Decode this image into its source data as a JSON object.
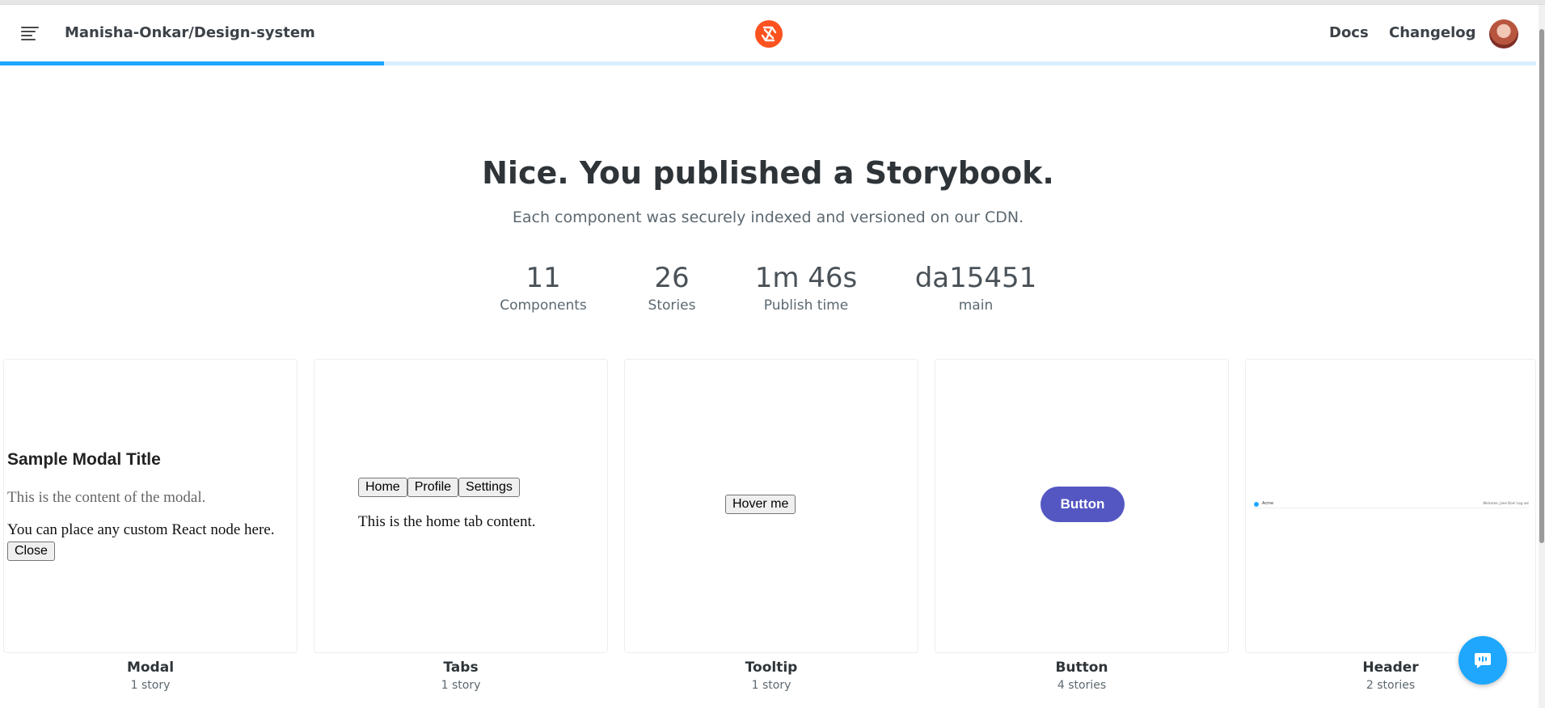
{
  "header": {
    "repo_name": "Manisha-Onkar/Design-system",
    "nav": {
      "docs": "Docs",
      "changelog": "Changelog"
    },
    "progress_fraction": 0.25,
    "accent_color": "#1ea7fd",
    "logo_color": "#ff4785"
  },
  "hero": {
    "title": "Nice. You published a Storybook.",
    "subtitle": "Each component was securely indexed and versioned on our CDN."
  },
  "stats": [
    {
      "value": "11",
      "label": "Components"
    },
    {
      "value": "26",
      "label": "Stories"
    },
    {
      "value": "1m 46s",
      "label": "Publish time"
    },
    {
      "value": "da15451",
      "label": "main"
    }
  ],
  "cards": [
    {
      "title": "Modal",
      "count": "1 story",
      "preview": {
        "heading": "Sample Modal Title",
        "content": "This is the content of the modal.",
        "node_text": "You can place any custom React node here.",
        "close_label": "Close"
      }
    },
    {
      "title": "Tabs",
      "count": "1 story",
      "preview": {
        "tabs": [
          "Home",
          "Profile",
          "Settings"
        ],
        "content": "This is the home tab content."
      }
    },
    {
      "title": "Tooltip",
      "count": "1 story",
      "preview": {
        "button_label": "Hover me"
      }
    },
    {
      "title": "Button",
      "count": "4 stories",
      "preview": {
        "button_label": "Button",
        "color": "#5457c2"
      }
    },
    {
      "title": "Header",
      "count": "2 stories",
      "preview": {
        "brand": "Acme",
        "right_text": "Welcome, Jane Doe!   Log out"
      }
    }
  ],
  "chat": {
    "icon": "chat-bubble-icon"
  }
}
